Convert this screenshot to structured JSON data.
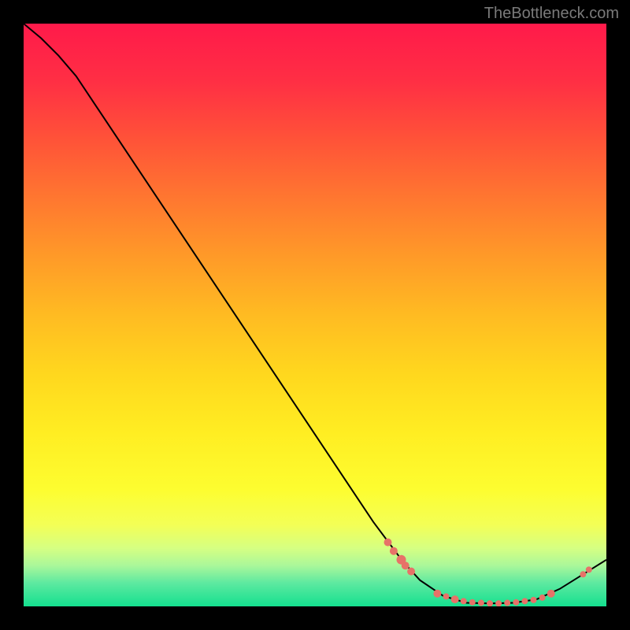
{
  "watermark": "TheBottleneck.com",
  "chart_data": {
    "type": "line",
    "title": "",
    "xlabel": "",
    "ylabel": "",
    "xlim": [
      0,
      100
    ],
    "ylim": [
      0,
      100
    ],
    "curve": [
      {
        "x": 0.0,
        "y": 100.0
      },
      {
        "x": 3.0,
        "y": 97.5
      },
      {
        "x": 6.0,
        "y": 94.5
      },
      {
        "x": 9.0,
        "y": 91.0
      },
      {
        "x": 12.0,
        "y": 86.5
      },
      {
        "x": 15.0,
        "y": 82.0
      },
      {
        "x": 20.0,
        "y": 74.5
      },
      {
        "x": 25.0,
        "y": 67.0
      },
      {
        "x": 30.0,
        "y": 59.5
      },
      {
        "x": 35.0,
        "y": 52.0
      },
      {
        "x": 40.0,
        "y": 44.5
      },
      {
        "x": 45.0,
        "y": 37.0
      },
      {
        "x": 50.0,
        "y": 29.5
      },
      {
        "x": 55.0,
        "y": 22.0
      },
      {
        "x": 60.0,
        "y": 14.5
      },
      {
        "x": 65.0,
        "y": 7.8
      },
      {
        "x": 68.0,
        "y": 4.5
      },
      {
        "x": 72.0,
        "y": 1.8
      },
      {
        "x": 76.0,
        "y": 0.6
      },
      {
        "x": 80.0,
        "y": 0.5
      },
      {
        "x": 84.0,
        "y": 0.6
      },
      {
        "x": 88.0,
        "y": 1.2
      },
      {
        "x": 92.0,
        "y": 3.0
      },
      {
        "x": 96.0,
        "y": 5.5
      },
      {
        "x": 100.0,
        "y": 8.0
      }
    ],
    "scatter_points": [
      {
        "x": 62.5,
        "y": 11.0,
        "r": 5
      },
      {
        "x": 63.5,
        "y": 9.5,
        "r": 5
      },
      {
        "x": 64.8,
        "y": 8.0,
        "r": 6
      },
      {
        "x": 65.5,
        "y": 7.0,
        "r": 5
      },
      {
        "x": 66.5,
        "y": 6.0,
        "r": 5
      },
      {
        "x": 71.0,
        "y": 2.2,
        "r": 5
      },
      {
        "x": 72.5,
        "y": 1.7,
        "r": 4
      },
      {
        "x": 74.0,
        "y": 1.2,
        "r": 5
      },
      {
        "x": 75.5,
        "y": 0.9,
        "r": 4
      },
      {
        "x": 77.0,
        "y": 0.7,
        "r": 4
      },
      {
        "x": 78.5,
        "y": 0.6,
        "r": 4
      },
      {
        "x": 80.0,
        "y": 0.5,
        "r": 4
      },
      {
        "x": 81.5,
        "y": 0.5,
        "r": 4
      },
      {
        "x": 83.0,
        "y": 0.6,
        "r": 4
      },
      {
        "x": 84.5,
        "y": 0.7,
        "r": 4
      },
      {
        "x": 86.0,
        "y": 0.9,
        "r": 4
      },
      {
        "x": 87.5,
        "y": 1.1,
        "r": 4
      },
      {
        "x": 89.0,
        "y": 1.5,
        "r": 4
      },
      {
        "x": 90.5,
        "y": 2.2,
        "r": 5
      },
      {
        "x": 96.0,
        "y": 5.5,
        "r": 4
      },
      {
        "x": 97.0,
        "y": 6.3,
        "r": 4
      }
    ],
    "gradient_stops": [
      {
        "offset": 0.0,
        "color": "#ff1a4a"
      },
      {
        "offset": 0.1,
        "color": "#ff2f44"
      },
      {
        "offset": 0.2,
        "color": "#ff5338"
      },
      {
        "offset": 0.3,
        "color": "#ff7730"
      },
      {
        "offset": 0.4,
        "color": "#ff9a28"
      },
      {
        "offset": 0.5,
        "color": "#ffbb22"
      },
      {
        "offset": 0.6,
        "color": "#ffd71e"
      },
      {
        "offset": 0.7,
        "color": "#ffed22"
      },
      {
        "offset": 0.8,
        "color": "#fdfd30"
      },
      {
        "offset": 0.86,
        "color": "#f3ff56"
      },
      {
        "offset": 0.9,
        "color": "#d6ff82"
      },
      {
        "offset": 0.93,
        "color": "#aaf79a"
      },
      {
        "offset": 0.96,
        "color": "#5de9a0"
      },
      {
        "offset": 1.0,
        "color": "#14e08f"
      }
    ],
    "point_color": "#e77268",
    "curve_color": "#000000"
  }
}
